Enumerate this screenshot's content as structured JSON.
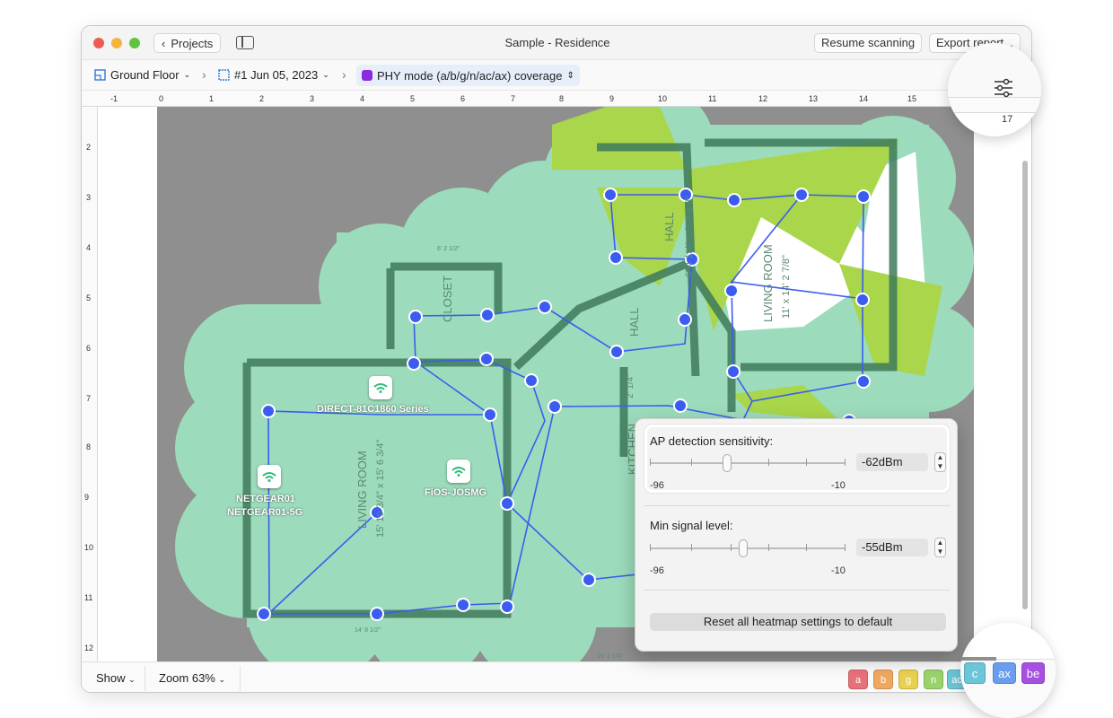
{
  "window": {
    "title": "Sample - Residence",
    "back_label": "Projects",
    "resume_label": "Resume scanning",
    "export_label": "Export report..."
  },
  "breadcrumb": {
    "floor": "Ground Floor",
    "scan": "#1 Jun 05, 2023",
    "mode": "PHY mode (a/b/g/n/ac/ax) coverage"
  },
  "ruler": {
    "top": [
      "-1",
      "0",
      "1",
      "2",
      "3",
      "4",
      "5",
      "6",
      "7",
      "8",
      "9",
      "10",
      "11",
      "12",
      "13",
      "14",
      "15",
      "17"
    ],
    "left": [
      "2",
      "3",
      "4",
      "5",
      "6",
      "7",
      "8",
      "9",
      "10",
      "11",
      "12"
    ]
  },
  "access_points": [
    {
      "name": "DIRECT-81C1860 Series"
    },
    {
      "name": "NETGEAR01"
    },
    {
      "name": "NETGEAR01-5G"
    },
    {
      "name": "FiOS-JOSMG"
    }
  ],
  "plan_labels": {
    "closet": "CLOSET",
    "hall1": "HALL",
    "hall2": "HALL",
    "living_room_1": "LIVING ROOM",
    "living_room_1_dims": "15' 10 3/4\" x 15' 6 3/4\"",
    "living_room_2": "LIVING ROOM",
    "living_room_2_dims": "11' x 14' 2 7/8\"",
    "kitchen": "KITCHEN",
    "hall_dims": "6' 4 1/4\" x 9' 4 3/8\"",
    "dim1": "6' 2 1/2\"",
    "dim2": "14' 8 1/2\"",
    "dim3": "16' 2 1/4\"",
    "dim4": "2' 1/4\""
  },
  "panel": {
    "sensitivity_label": "AP detection sensitivity:",
    "sensitivity_value": "-62dBm",
    "sensitivity_level": -62,
    "sensitivity_min": "-96",
    "sensitivity_max": "-10",
    "min_signal_label": "Min signal level:",
    "min_signal_value": "-55dBm",
    "min_signal_level": -55,
    "min_signal_min": "-96",
    "min_signal_max": "-10",
    "reset_label": "Reset all heatmap settings to default"
  },
  "bottom": {
    "show_label": "Show",
    "zoom_label": "Zoom 63%"
  },
  "phy_chips": [
    {
      "label": "a",
      "color": "#e8707a"
    },
    {
      "label": "b",
      "color": "#f0a860"
    },
    {
      "label": "g",
      "color": "#e8d050"
    },
    {
      "label": "n",
      "color": "#9ad36b"
    },
    {
      "label": "ac",
      "color": "#6cc6d8"
    },
    {
      "label": "ax",
      "color": "#6a9cf0"
    },
    {
      "label": "be",
      "color": "#a64fe0"
    }
  ],
  "colors": {
    "coverage_teal": "#9cdcbc",
    "coverage_green": "#a9d64a",
    "route_blue": "#3b5cf0",
    "mode_purple": "#8a2be2"
  },
  "icons": {
    "settings": "sliders-icon",
    "wifi": "wifi-icon"
  }
}
